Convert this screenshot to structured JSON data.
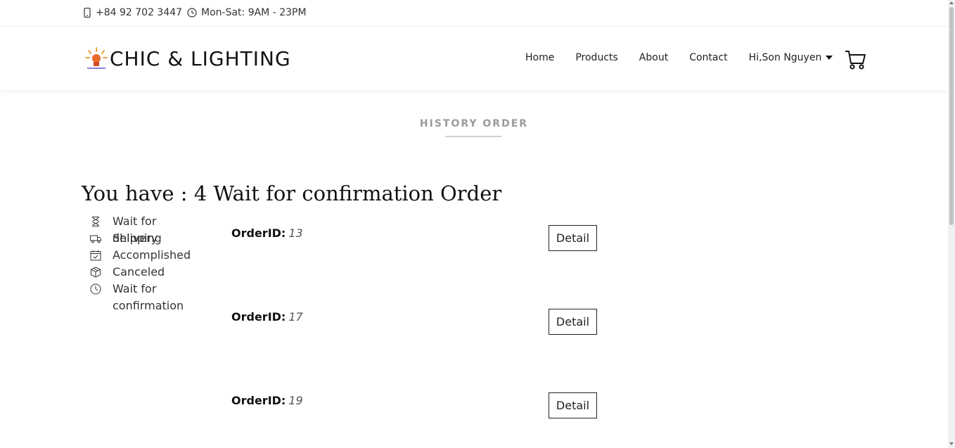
{
  "topbar": {
    "phone": "+84 92 702 3447",
    "hours": "Mon-Sat: 9AM - 23PM"
  },
  "header": {
    "logo_text": "CHIC & LIGHTING",
    "nav": [
      "Home",
      "Products",
      "About",
      "Contact"
    ],
    "user_label": "Hi,Son Nguyen"
  },
  "page": {
    "section_title": "HISTORY ORDER",
    "headline": "You have : 4 Wait for confirmation Order"
  },
  "status_list": [
    {
      "label": "Wait for delivery",
      "icon": "hourglass-icon"
    },
    {
      "label": "Shipping",
      "icon": "truck-icon"
    },
    {
      "label": "Accomplished",
      "icon": "calendar-check-icon"
    },
    {
      "label": "Canceled",
      "icon": "box-icon"
    },
    {
      "label": "Wait for confirmation",
      "icon": "clock-icon"
    }
  ],
  "orders": [
    {
      "key": "OrderID:",
      "id": "13",
      "button": "Detail"
    },
    {
      "key": "OrderID:",
      "id": "17",
      "button": "Detail"
    },
    {
      "key": "OrderID:",
      "id": "19",
      "button": "Detail"
    }
  ]
}
